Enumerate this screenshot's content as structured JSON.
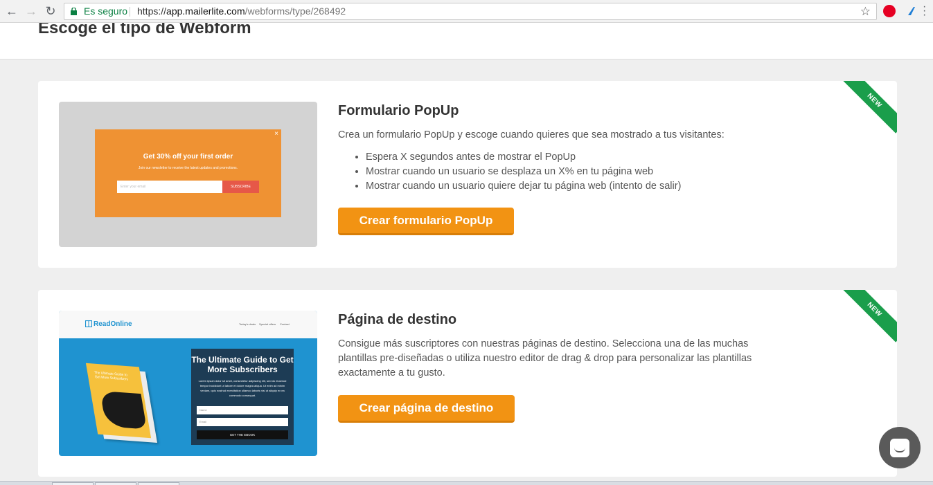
{
  "browser": {
    "secure_label": "Es seguro",
    "url_scheme": "https://",
    "url_host": "app.mailerlite.com",
    "url_path": "/webforms/type/268492",
    "star": "☆"
  },
  "page": {
    "title": "Escoge el tipo de Webform"
  },
  "cards": [
    {
      "badge": "NEW",
      "title": "Formulario PopUp",
      "description": "Crea un formulario PopUp y escoge cuando quieres que sea mostrado a tus visitantes:",
      "bullets": [
        "Espera X segundos antes de mostrar el PopUp",
        "Mostrar cuando un usuario se desplaza un X% en tu página web",
        "Mostrar cuando un usuario quiere dejar tu página web (intento de salir)"
      ],
      "button": "Crear formulario PopUp",
      "preview": {
        "close": "×",
        "heading": "Get 30% off your first order",
        "subheading": "Join our newsletter to receive the latest updates and promotions.",
        "input_placeholder": "Enter your email",
        "button": "SUBSCRIBE"
      }
    },
    {
      "badge": "NEW",
      "title": "Página de destino",
      "description": "Consigue más suscriptores con nuestras páginas de destino. Selecciona una de las muchas plantillas pre-diseñadas o utiliza nuestro editor de drag & drop para personalizar las plantillas exactamente a tu gusto.",
      "button": "Crear página de destino",
      "preview": {
        "logo": "ReadOnline",
        "nav": [
          "Today's deals",
          "Special offers",
          "Contact"
        ],
        "book_title": "The Ultimate Guide to Get More Subscribers",
        "box_title": "The Ultimate Guide to Get More Subscribers",
        "box_text": "Lorem ipsum dolor sit amet, consectetur adipiscing elit, sed do eiusmod tempor incididunt ut labore et dolore magna aliqua. Ut enim ad minim veniam, quis nostrud exercitation ullamco laboris nisi ut aliquip ex ea commodo consequat.",
        "field_name": "Name",
        "field_email": "Email",
        "button": "GET THE EBOOK"
      }
    }
  ],
  "colors": {
    "accent": "#f29313",
    "badge": "#1a9e4b",
    "popup": "#ef9233",
    "landing_bg": "#1f93d0"
  }
}
